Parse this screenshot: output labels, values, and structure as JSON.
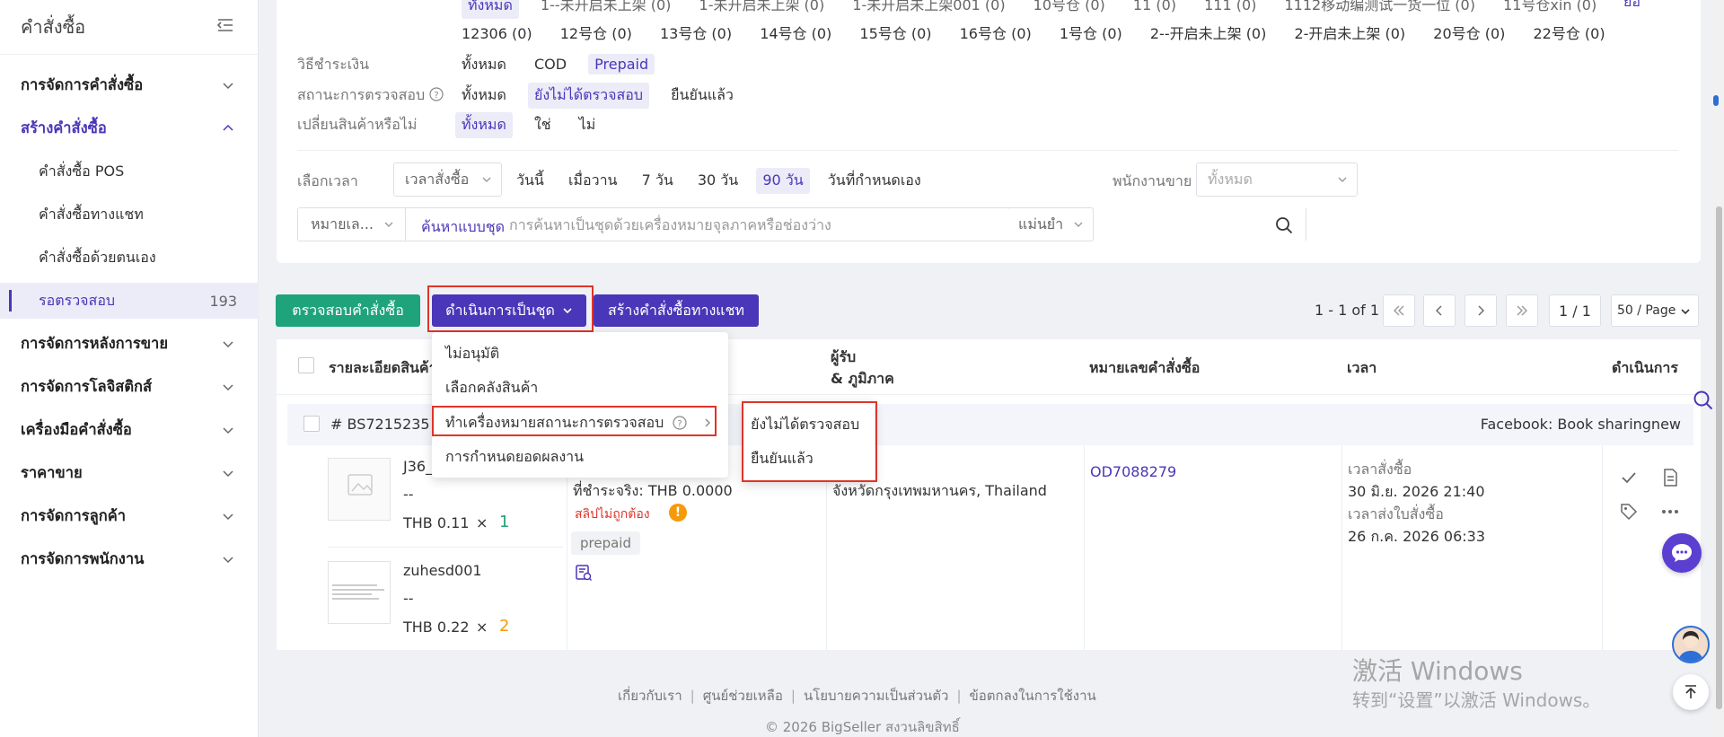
{
  "sidebar": {
    "title": "คำสั่งซื้อ",
    "groups": [
      {
        "label": "การจัดการคำสั่งซื้อ",
        "expanded": false
      },
      {
        "label": "สร้างคำสั่งซื้อ",
        "expanded": true
      },
      {
        "label": "การจัดการหลังการขาย",
        "expanded": false
      },
      {
        "label": "การจัดการโลจิสติกส์",
        "expanded": false
      },
      {
        "label": "เครื่องมือคำสั่งซื้อ",
        "expanded": false
      },
      {
        "label": "ราคาขาย",
        "expanded": false
      },
      {
        "label": "การจัดการลูกค้า",
        "expanded": false
      },
      {
        "label": "การจัดการพนักงาน",
        "expanded": false
      }
    ],
    "sub_items": [
      {
        "label": "คำสั่งซื้อ POS"
      },
      {
        "label": "คำสั่งซื้อทางแชท"
      },
      {
        "label": "คำสั่งซื้อด้วยตนเอง"
      },
      {
        "label": "รอตรวจสอบ",
        "count": "193",
        "selected": true
      }
    ]
  },
  "filters": {
    "warehouse_row_partial": [
      "ทั้งหมด",
      "1--未开启未上架 (0)",
      "1-未开启未上架 (0)",
      "1-未开启未上架001 (0)",
      "10号仓 (0)",
      "11 (0)",
      "111 (0)",
      "1112移动编测试一货一位 (0)",
      "11号仓xin (0)"
    ],
    "warehouse_more": "ย่อ",
    "warehouse_row": [
      "12306 (0)",
      "12号仓 (0)",
      "13号仓 (0)",
      "14号仓 (0)",
      "15号仓 (0)",
      "16号仓 (0)",
      "1号仓 (0)",
      "2--开启未上架 (0)",
      "2-开启未上架 (0)",
      "20号仓 (0)",
      "22号仓 (0)"
    ],
    "payment": {
      "label": "วิธีชำระเงิน",
      "options": [
        "ทั้งหมด",
        "COD",
        "Prepaid"
      ],
      "selected": "Prepaid"
    },
    "review": {
      "label": "สถานะการตรวจสอบ",
      "options": [
        "ทั้งหมด",
        "ยังไม่ได้ตรวจสอบ",
        "ยืนยันแล้ว"
      ],
      "selected": "ยังไม่ได้ตรวจสอบ"
    },
    "exchange": {
      "label": "เปลี่ยนสินค้าหรือไม่",
      "options": [
        "ทั้งหมด",
        "ใช่",
        "ไม่"
      ],
      "selected": "ทั้งหมด"
    },
    "time": {
      "label": "เลือกเวลา",
      "type_value": "เวลาสั่งซื้อ",
      "options": [
        "วันนี้",
        "เมื่อวาน",
        "7 วัน",
        "30 วัน",
        "90 วัน",
        "วันที่กำหนดเอง"
      ],
      "selected": "90 วัน"
    },
    "salesperson": {
      "label": "พนักงานขาย",
      "placeholder": "ทั้งหมด"
    },
    "search": {
      "field_value": "หมายเล...",
      "mode": "ค้นหาแบบชุด",
      "placeholder": "การค้นหาเป็นชุดด้วยเครื่องหมายจุลภาคหรือช่องว่าง",
      "match_value": "แม่นยำ"
    }
  },
  "actions": {
    "review_button": "ตรวจสอบคำสั่งซื้อ",
    "batch_button": "ดำเนินการเป็นชุด",
    "chat_order_button": "สร้างคำสั่งซื้อทางแชท"
  },
  "pager": {
    "info": "1 - 1 of 1",
    "page": "1 / 1",
    "size": "50 / Page"
  },
  "batch_menu": {
    "items": [
      "ไม่อนุมัติ",
      "เลือกคลังสินค้า",
      "ทำเครื่องหมายสถานะการตรวจสอบ",
      "การกำหนดยอดผลงาน"
    ],
    "submenu": [
      "ยังไม่ได้ตรวจสอบ",
      "ยืนยันแล้ว"
    ]
  },
  "table": {
    "headers": {
      "product": "รายละเอียดสินค้า",
      "recipient_1": "ผู้รับ",
      "recipient_2": "& ภูมิภาค",
      "order_no": "หมายเลขคำสั่งซื้อ",
      "time": "เวลา",
      "actions": "ดำเนินการ"
    },
    "order": {
      "id": "# BS7215235",
      "source": "Facebook: Book sharingnew",
      "items": [
        {
          "sku": "J36_",
          "variant": "--",
          "price": "THB 0.11",
          "qty": "1",
          "qty_color": "#1fa37a"
        },
        {
          "sku": "zuhesd001",
          "variant": "--",
          "price": "THB 0.22",
          "qty": "2",
          "qty_color": "#f59a0b"
        }
      ],
      "paid": "ที่ชำระจริง: THB 0.0000",
      "slip_warning": "สลิปไม่ถูกต้อง",
      "payment_tag": "prepaid",
      "region": "จังหวัดกรุงเทพมหานคร, Thailand",
      "order_number": "OD7088279",
      "order_time_label": "เวลาสั่งซื้อ",
      "order_time": "30 มิ.ย. 2026 21:40",
      "invoice_time_label": "เวลาส่งใบสั่งซื้อ",
      "invoice_time": "26 ก.ค. 2026 06:33"
    }
  },
  "footer": {
    "links": [
      "เกี่ยวกับเรา",
      "ศูนย์ช่วยเหลือ",
      "นโยบายความเป็นส่วนตัว",
      "ข้อตกลงในการใช้งาน"
    ],
    "copyright": "© 2026 BigSeller สงวนลิขสิทธิ์"
  },
  "watermark": {
    "line1": "激活 Windows",
    "line2": "转到“设置”以激活 Windows。"
  },
  "colors": {
    "primary": "#4a36b8",
    "green": "#1fa37a",
    "warning": "#f59a0b",
    "danger": "#e0342a"
  }
}
